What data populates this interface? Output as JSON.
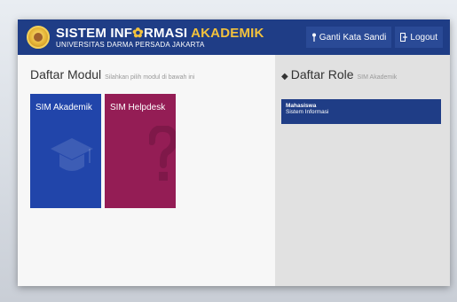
{
  "header": {
    "title_part1": "SISTEM INF",
    "title_part2": "RMASI",
    "title_accent": "AKADEMIK",
    "subtitle": "UNIVERSITAS DARMA PERSADA JAKARTA",
    "change_password_label": "Ganti Kata Sandi",
    "logout_label": "Logout"
  },
  "modules_section": {
    "title": "Daftar Modul",
    "subtitle": "Silahkan pilih modul di bawah ini",
    "items": [
      {
        "label": "SIM Akademik",
        "icon": "graduation-cap-icon",
        "color": "#2145aa"
      },
      {
        "label": "SIM Helpdesk",
        "icon": "question-mark-icon",
        "color": "#941d55"
      }
    ]
  },
  "roles_section": {
    "title": "Daftar Role",
    "subtitle": "SIM Akademik",
    "items": [
      {
        "name": "Mahasiswa",
        "program": "Sistem Informasi"
      }
    ]
  },
  "colors": {
    "navbar": "#1f3d86",
    "accent": "#f3c23d"
  }
}
